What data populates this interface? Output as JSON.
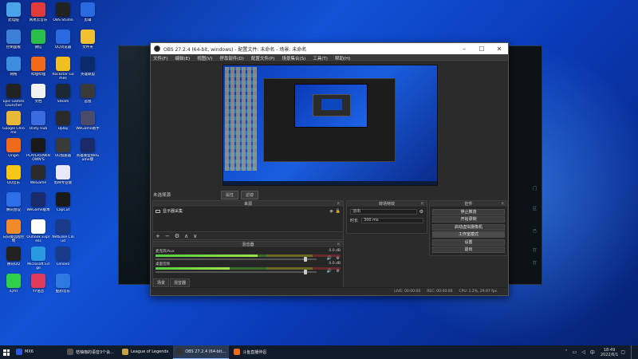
{
  "desktop": {
    "icons": [
      {
        "label": "此电脑",
        "color": "#4aa3e8"
      },
      {
        "label": "控制面板",
        "color": "#3b7fd8"
      },
      {
        "label": "网络",
        "color": "#3d8de0"
      },
      {
        "label": "Epic Games Launcher",
        "color": "#222222"
      },
      {
        "label": "Google Chrome",
        "color": "#e8b838"
      },
      {
        "label": "Origin",
        "color": "#f06a1a"
      },
      {
        "label": "QQ音乐",
        "color": "#f5c518"
      },
      {
        "label": "腾讯会议",
        "color": "#2d6fe8"
      },
      {
        "label": "向日葵远程控制",
        "color": "#f08a2a"
      },
      {
        "label": "腾讯QQ",
        "color": "#222222"
      },
      {
        "label": "iQIYI",
        "color": "#2fcf4a"
      },
      {
        "label": "网易云音乐",
        "color": "#e03a3a"
      },
      {
        "label": "微信",
        "color": "#2bbd4a"
      },
      {
        "label": "哔哩哔哩",
        "color": "#f06a1a"
      },
      {
        "label": "文档",
        "color": "#f2f2f2"
      },
      {
        "label": "Unity Hub",
        "color": "#3b6be0"
      },
      {
        "label": "PLAYERUNKNOWN'S",
        "color": "#1a1a1a"
      },
      {
        "label": "WeGame",
        "color": "#2a2a2a"
      },
      {
        "label": "WeGame版本",
        "color": "#1a2a6a"
      },
      {
        "label": "Outlook Express",
        "color": "#ffffff"
      },
      {
        "label": "Microsoft Edge",
        "color": "#2a9ae0"
      },
      {
        "label": "YY语音",
        "color": "#e03a5a"
      },
      {
        "label": "OBS Studio",
        "color": "#222222"
      },
      {
        "label": "QQ浏览器",
        "color": "#2a6ae0"
      },
      {
        "label": "Rockstar Games",
        "color": "#f0c020"
      },
      {
        "label": "Steam",
        "color": "#1b2838"
      },
      {
        "label": "Uplay",
        "color": "#2a2a2a"
      },
      {
        "label": "UU加速器",
        "color": "#3a3a3a"
      },
      {
        "label": "剪映专业版",
        "color": "#e8e8f8"
      },
      {
        "label": "CapCut",
        "color": "#1a1a1a"
      },
      {
        "label": "NetEase Cloud",
        "color": "#1a3a8a"
      },
      {
        "label": "Lenovo",
        "color": "#1a3a8a"
      },
      {
        "label": "酷狗音乐",
        "color": "#2a7ae0"
      },
      {
        "label": "剪辑",
        "color": "#2a6ae0"
      },
      {
        "label": "文件夹",
        "color": "#f0c030"
      },
      {
        "label": "英雄联盟",
        "color": "#0a2a6a"
      },
      {
        "label": "远程",
        "color": "#3a3a3a"
      },
      {
        "label": "WeGame助手",
        "color": "#4a4a6a"
      },
      {
        "label": "英雄联盟WeGame版",
        "color": "#1a2a6a"
      }
    ]
  },
  "lol_window": {
    "side_text": [
      "门",
      "区",
      "已",
      "打",
      "打"
    ]
  },
  "obs": {
    "title": "OBS 27.2.4 (64-bit, windows) - 配置文件: 未命名 - 场景: 未命名",
    "menu": [
      "文件(F)",
      "编辑(E)",
      "视图(V)",
      "停靠部件(D)",
      "配置文件(P)",
      "场景集合(S)",
      "工具(T)",
      "帮助(H)"
    ],
    "scene_label": "未选择源",
    "scene_tabs": [
      "属性",
      "滤镜"
    ],
    "panels": {
      "sources": {
        "title": "来源",
        "items": [
          {
            "label": "显示器采集"
          }
        ]
      },
      "transitions": {
        "title": "转场特效",
        "type": "淡出",
        "duration_label": "时长",
        "duration": "300 ms"
      },
      "controls": {
        "title": "控件",
        "buttons": [
          "停止推流",
          "开始录制",
          "启动虚拟摄像机",
          "工作室模式",
          "设置",
          "退出"
        ]
      },
      "mixer": {
        "title": "混音器",
        "channels": [
          {
            "name": "麦克风/Aux",
            "db": "0.0 dB",
            "level": 0.55,
            "fader": 0.92
          },
          {
            "name": "桌面音频",
            "db": "0.0 dB",
            "level": 0.4,
            "fader": 0.92
          }
        ],
        "tabs": [
          "场景",
          "混音器"
        ]
      }
    },
    "status": {
      "live": "LIVE: 00:00:00",
      "rec": "REC: 00:00:00",
      "cpu": "CPU: 1.2%, 29.97 fps"
    }
  },
  "taskbar": {
    "items": [
      {
        "label": "MX6",
        "color": "#2a5ae0",
        "active": false
      },
      {
        "label": "桔柚咖的语音3个会...",
        "color": "#555555",
        "active": false
      },
      {
        "label": "League of Legends",
        "color": "#c8a040",
        "active": false
      },
      {
        "label": "OBS 27.2.4 (64-bit...",
        "color": "#333333",
        "active": true
      },
      {
        "label": "斗鱼直播伴侣",
        "color": "#f06a1a",
        "active": false
      }
    ],
    "clock_time": "18:49",
    "clock_date": "2022/6/1"
  }
}
